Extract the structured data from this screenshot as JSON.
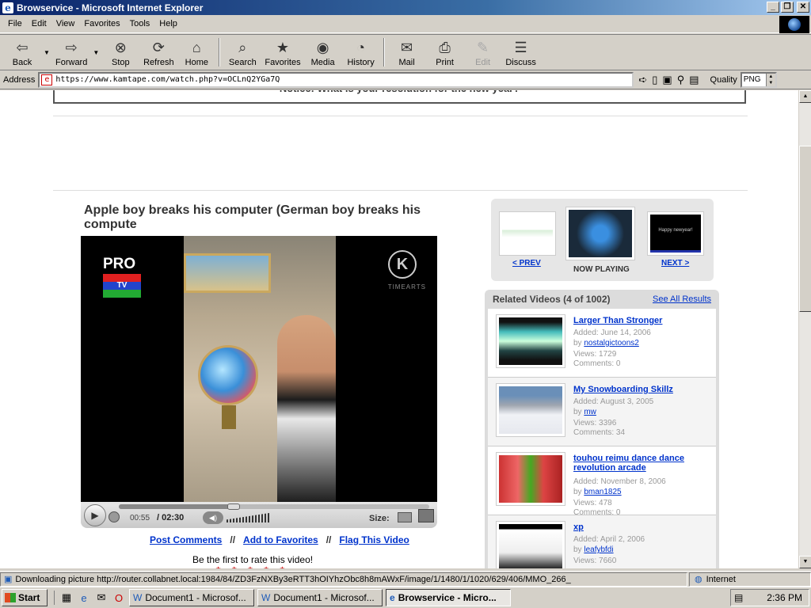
{
  "window": {
    "title": "Browservice - Microsoft Internet Explorer",
    "app_icon": "ie-page-icon"
  },
  "menu": [
    "File",
    "Edit",
    "View",
    "Favorites",
    "Tools",
    "Help"
  ],
  "toolbar": {
    "buttons": [
      {
        "label": "Back",
        "icon": "back-arrow-icon"
      },
      {
        "label": "Forward",
        "icon": "forward-arrow-icon"
      },
      {
        "label": "Stop",
        "icon": "stop-icon"
      },
      {
        "label": "Refresh",
        "icon": "refresh-icon"
      },
      {
        "label": "Home",
        "icon": "home-icon"
      },
      {
        "label": "Search",
        "icon": "search-icon"
      },
      {
        "label": "Favorites",
        "icon": "favorites-icon"
      },
      {
        "label": "Media",
        "icon": "media-icon"
      },
      {
        "label": "History",
        "icon": "history-icon"
      },
      {
        "label": "Mail",
        "icon": "mail-icon"
      },
      {
        "label": "Print",
        "icon": "print-icon"
      },
      {
        "label": "Edit",
        "icon": "edit-icon"
      },
      {
        "label": "Discuss",
        "icon": "discuss-icon"
      }
    ]
  },
  "address": {
    "label": "Address",
    "url": "https://www.kamtape.com/watch.php?v=OCLnQ2YGa7Q",
    "quality_label": "Quality",
    "quality_value": "PNG"
  },
  "page": {
    "notice": "Notice: What is your resolution for the new year?",
    "video_title": "Apple boy breaks his computer (German boy breaks his compute",
    "player": {
      "pro_text": "PRO",
      "pro_sub": "TV",
      "k_logo": "K",
      "k_caption": "TIMEARTS",
      "time_current": "00:55",
      "time_total": "/ 02:30",
      "progress_fraction": 0.37,
      "size_label": "Size:"
    },
    "actions": [
      "Post Comments",
      "Add to Favorites",
      "Flag This Video"
    ],
    "rate_text": "Be the first to rate this video!",
    "nav": {
      "prev_label": "< PREV",
      "now_label": "NOW PLAYING",
      "next_label": "NEXT >",
      "next_thumb_text": "Happy newyear!"
    },
    "related": {
      "title": "Related Videos (4 of 1002)",
      "see_all": "See All Results",
      "items": [
        {
          "title": "Larger Than Stronger",
          "added": "Added: June 14, 2006",
          "by_prefix": "by",
          "user": "nostalgictoons2",
          "views": "Views: 1729",
          "comments": "Comments: 0"
        },
        {
          "title": "My Snowboarding Skillz",
          "added": "Added: August 3, 2005",
          "by_prefix": "by",
          "user": "mw",
          "views": "Views: 3396",
          "comments": "Comments: 34"
        },
        {
          "title": "touhou reimu dance dance revolution arcade",
          "added": "Added: November 8, 2006",
          "by_prefix": "by",
          "user": "bman1825",
          "views": "Views: 478",
          "comments": "Comments: 0"
        },
        {
          "title": "xp",
          "added": "Added: April 2, 2006",
          "by_prefix": "by",
          "user": "leafybfdi",
          "views": "Views: 7660",
          "comments": ""
        }
      ]
    }
  },
  "status": {
    "text": "Downloading picture http://router.collabnet.local:1984/84/ZD3FzNXBy3eRTT3hOIYhzObc8h8mAWxF/image/1/1480/1/1020/629/406/MMO_266_",
    "zone": "Internet"
  },
  "taskbar": {
    "start": "Start",
    "tasks": [
      "Document1 - Microsof...",
      "Document1 - Microsof...",
      "Browservice - Micro..."
    ],
    "clock": "2:36 PM"
  }
}
